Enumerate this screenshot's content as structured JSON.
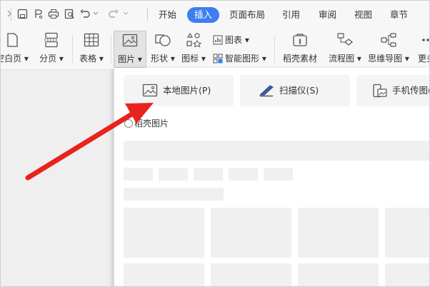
{
  "toolbar": {
    "tabs": [
      "开始",
      "插入",
      "页面布局",
      "引用",
      "审阅",
      "视图",
      "章节"
    ],
    "active_tab": "插入",
    "active_color": "#3d7ff0"
  },
  "ribbon": {
    "blank_page": "空白页",
    "page_break": "分页",
    "table": "表格",
    "picture": "图片",
    "shape": "形状",
    "icon": "图标",
    "chart": "图表",
    "smart_art": "智能图形",
    "docer_material": "稻壳素材",
    "flowchart": "流程图",
    "mindmap": "思维导图",
    "more": "更多"
  },
  "panel": {
    "local_picture": "本地图片(P)",
    "scanner": "扫描仪(S)",
    "phone_picture": "手机传图(",
    "section_title": "稻壳图片"
  },
  "annotation": {
    "arrow_color": "#e8231d"
  }
}
